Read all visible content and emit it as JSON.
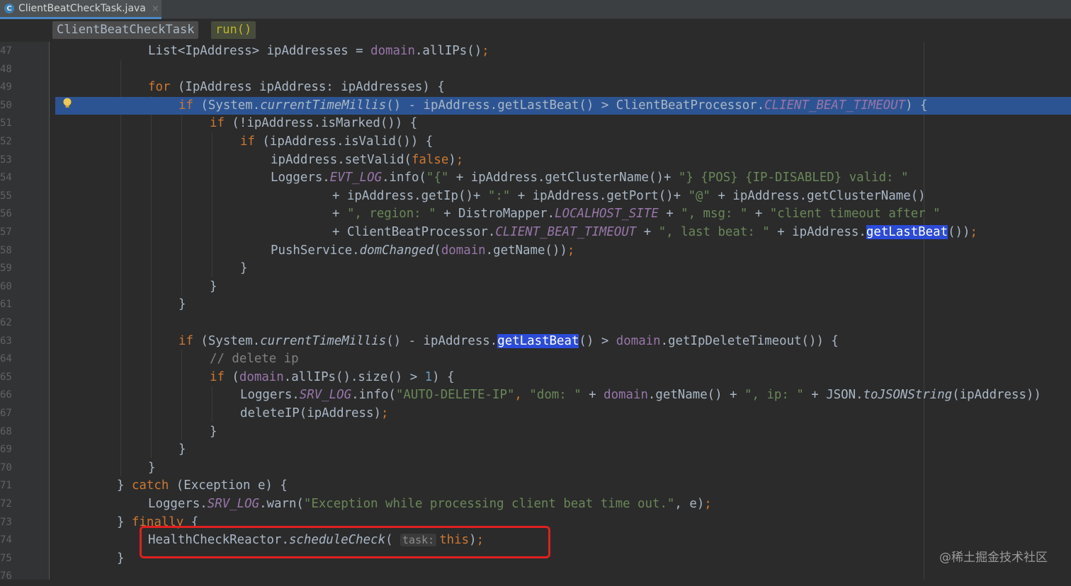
{
  "tab": {
    "icon": "class-c-icon",
    "label": "ClientBeatCheckTask.java",
    "close": "×"
  },
  "breadcrumbs": {
    "class": "ClientBeatCheckTask",
    "method": "run()"
  },
  "line_numbers": [
    "47",
    "48",
    "49",
    "50",
    "51",
    "52",
    "53",
    "54",
    "55",
    "56",
    "57",
    "58",
    "59",
    "60",
    "61",
    "62",
    "63",
    "64",
    "65",
    "66",
    "67",
    "68",
    "69",
    "70",
    "71",
    "72",
    "73",
    "74",
    "75",
    "76"
  ],
  "code": {
    "l47": {
      "a": "List<IpAddress> ipAddresses = ",
      "b": "domain",
      "c": ".allIPs()",
      "d": ";"
    },
    "l49": {
      "a": "for",
      "b": " (IpAddress ipAddress: ipAddresses) {"
    },
    "l50": {
      "a": "if",
      "b": " (System.",
      "c": "currentTimeMillis",
      "d": "() - ipAddress.getLastBeat() > ClientBeatProcessor.",
      "e": "CLIENT_BEAT_TIMEOUT",
      "f": ") {"
    },
    "l51": {
      "a": "if",
      "b": " (!ipAddress.isMarked()) {"
    },
    "l52": {
      "a": "if",
      "b": " (ipAddress.isValid()) {"
    },
    "l53": {
      "a": "ipAddress.setValid(",
      "b": "false",
      "c": ")",
      "d": ";"
    },
    "l54": {
      "a": "Loggers.",
      "b": "EVT_LOG",
      "c": ".info(",
      "d": "\"{\"",
      "e": " + ipAddress.getClusterName()+ ",
      "f": "\"} {POS} {IP-DISABLED} valid: \""
    },
    "l55": {
      "a": "+ ipAddress.getIp()+ ",
      "b": "\":\"",
      "c": " + ipAddress.getPort()+ ",
      "d": "\"@\"",
      "e": " + ipAddress.getClusterName()"
    },
    "l56": {
      "a": "+ ",
      "b": "\", region: \"",
      "c": " + DistroMapper.",
      "d": "LOCALHOST_SITE",
      "e": " + ",
      "f": "\", msg: \"",
      "g": " + ",
      "h": "\"client timeout after \""
    },
    "l57": {
      "a": "+ ClientBeatProcessor.",
      "b": "CLIENT_BEAT_TIMEOUT",
      "c": " + ",
      "d": "\", last beat: \"",
      "e": " + ipAddress.",
      "f": "getLastBeat",
      "g": "())",
      "h": ";"
    },
    "l58": {
      "a": "PushService.",
      "b": "domChanged",
      "c": "(",
      "d": "domain",
      "e": ".getName())",
      "f": ";"
    },
    "l59": {
      "a": "}"
    },
    "l60": {
      "a": "}"
    },
    "l61": {
      "a": "}"
    },
    "l63": {
      "a": "if",
      "b": " (System.",
      "c": "currentTimeMillis",
      "d": "() - ipAddress.",
      "e": "getLastBeat",
      "f": "() > ",
      "g": "domain",
      "h": ".getIpDeleteTimeout()) {"
    },
    "l64": {
      "a": "// delete ip"
    },
    "l65": {
      "a": "if",
      "b": " (",
      "c": "domain",
      "d": ".allIPs().size() > ",
      "e": "1",
      "f": ") {"
    },
    "l66": {
      "a": "Loggers.",
      "b": "SRV_LOG",
      "c": ".info(",
      "d": "\"AUTO-DELETE-IP\"",
      "e": ", ",
      "f": "\"dom: \"",
      "g": " + ",
      "h": "domain",
      "i": ".getName() + ",
      "j": "\", ip: \"",
      "k": " + JSON.",
      "l": "toJSONString",
      "m": "(ipAddress))"
    },
    "l67": {
      "a": "deleteIP(ipAddress)",
      "b": ";"
    },
    "l68": {
      "a": "}"
    },
    "l69": {
      "a": "}"
    },
    "l70": {
      "a": "}"
    },
    "l71": {
      "a": "} ",
      "b": "catch",
      "c": " (Exception e) {"
    },
    "l72": {
      "a": "Loggers.",
      "b": "SRV_LOG",
      "c": ".warn(",
      "d": "\"Exception while processing client beat time out.\"",
      "e": ", e)",
      "f": ";"
    },
    "l73": {
      "a": "} ",
      "b": "finally",
      "c": " {"
    },
    "l74": {
      "a": "HealthCheckReactor.",
      "b": "scheduleCheck",
      "c": "(",
      "d": "task:",
      "e": "this",
      "f": ")",
      "g": ";"
    },
    "l75": {
      "a": "}"
    }
  },
  "watermark": "@稀土掘金技术社区",
  "colors": {
    "background": "#2b2b2b",
    "current_line": "#2d5492",
    "keyword": "#cc7832",
    "string": "#6a8759",
    "field": "#9876aa",
    "annotation_box": "#e02020"
  }
}
